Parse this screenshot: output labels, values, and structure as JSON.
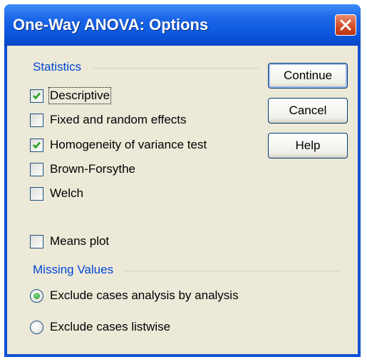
{
  "window": {
    "title": "One-Way ANOVA: Options"
  },
  "statistics": {
    "group_label": "Statistics",
    "options": [
      {
        "id": "descriptive",
        "label": "Descriptive",
        "checked": true
      },
      {
        "id": "fixed-random",
        "label": "Fixed and random effects",
        "checked": false
      },
      {
        "id": "homogeneity",
        "label": "Homogeneity of variance test",
        "checked": true
      },
      {
        "id": "brown-forsythe",
        "label": "Brown-Forsythe",
        "checked": false
      },
      {
        "id": "welch",
        "label": "Welch",
        "checked": false
      }
    ]
  },
  "means_plot": {
    "label": "Means plot",
    "checked": false
  },
  "missing_values": {
    "group_label": "Missing Values",
    "options": [
      {
        "label": "Exclude cases analysis by analysis",
        "selected": true
      },
      {
        "label": "Exclude cases listwise",
        "selected": false
      }
    ]
  },
  "buttons": {
    "continue": "Continue",
    "cancel": "Cancel",
    "help": "Help"
  },
  "colors": {
    "title_bar": "#0a56dc",
    "dialog_bg": "#ece9d8",
    "group_label": "#0046d5",
    "close_button": "#d34a26"
  },
  "icons": {
    "close": "close-icon",
    "check": "check-icon"
  }
}
